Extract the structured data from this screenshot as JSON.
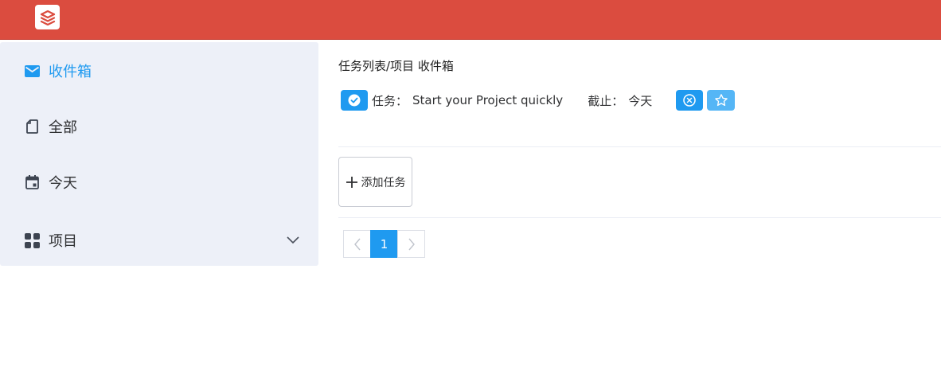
{
  "colors": {
    "header": "#db4c3f",
    "accent": "#1f9af0",
    "sidebar_bg": "#edf0f8"
  },
  "sidebar": {
    "items": [
      {
        "label": "收件箱",
        "icon": "mail-icon",
        "active": true
      },
      {
        "label": "全部",
        "icon": "document-icon",
        "active": false
      },
      {
        "label": "今天",
        "icon": "calendar-icon",
        "active": false
      },
      {
        "label": "项目",
        "icon": "grid-icon",
        "active": false,
        "expandable": true
      }
    ]
  },
  "main": {
    "breadcrumb": "任务列表/项目 收件箱",
    "task": {
      "prefix": "任务：",
      "name": "Start your Project quickly",
      "due_label": "截止：",
      "due_value": "今天"
    },
    "add_task_label": "添加任务",
    "pagination": {
      "current_page": "1"
    }
  }
}
